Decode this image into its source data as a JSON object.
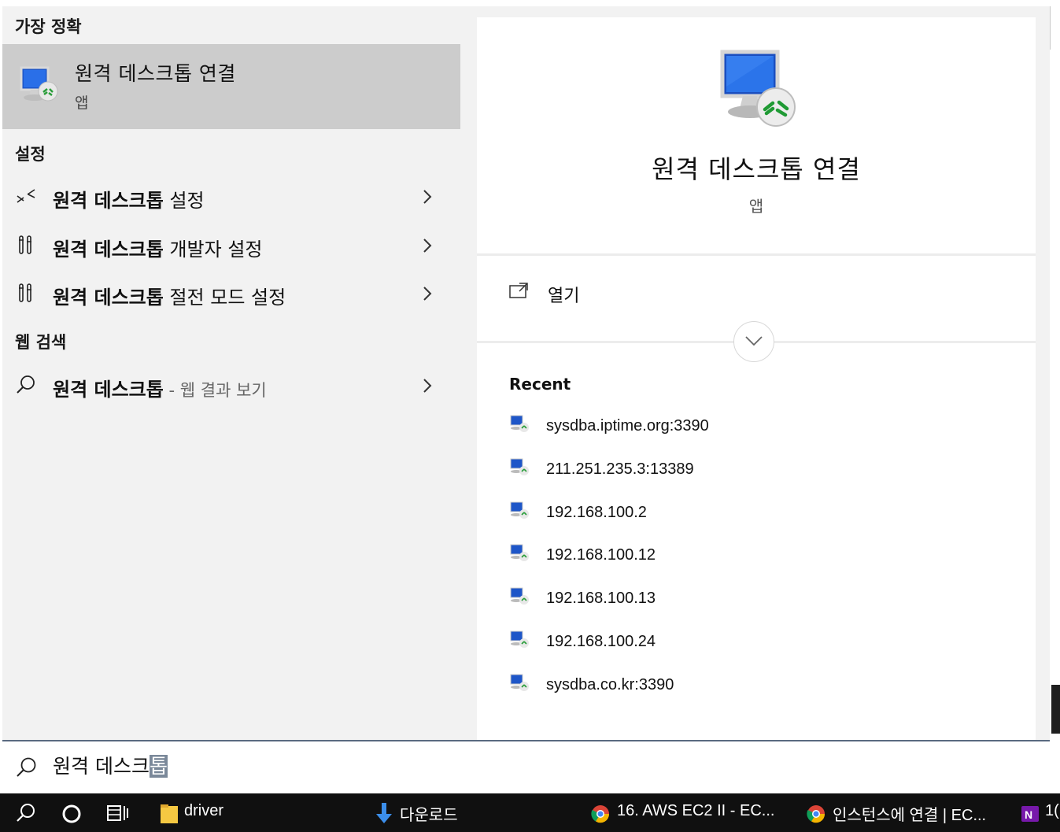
{
  "left": {
    "best_match_header": "가장 정확",
    "best_match": {
      "title": "원격 데스크톱 연결",
      "subtitle": "앱"
    },
    "settings_header": "설정",
    "settings": [
      {
        "bold": "원격 데스크톱",
        "rest": " 설정"
      },
      {
        "bold": "원격 데스크톱",
        "rest": " 개발자 설정"
      },
      {
        "bold": "원격 데스크톱",
        "rest": " 절전 모드 설정"
      }
    ],
    "web_header": "웹 검색",
    "web": {
      "bold": "원격 데스크톱",
      "suffix": " - 웹 결과 보기"
    }
  },
  "right": {
    "app_title": "원격 데스크톱 연결",
    "app_subtitle": "앱",
    "open_label": "열기",
    "recent_header": "Recent",
    "recent": [
      "sysdba.iptime.org:3390",
      "211.251.235.3:13389",
      "192.168.100.2",
      "192.168.100.12",
      "192.168.100.13",
      "192.168.100.24",
      "sysdba.co.kr:3390"
    ]
  },
  "search": {
    "typed": "원격 데스크",
    "selected": "톱"
  },
  "taskbar": {
    "folder_label": "driver",
    "downloads_label": "다운로드",
    "chrome_tab_1": "16. AWS EC2 II - EC...",
    "chrome_tab_2": "인스턴스에 연결 | EC...",
    "onenote_label": "1("
  },
  "colors": {
    "selected_bg": "#cccccc",
    "panel_bg": "#f2f2f2",
    "taskbar_bg": "#101010",
    "selection_highlight": "#7a8899"
  },
  "icons": [
    "remote-desktop-icon",
    "remote-settings-icon",
    "tools-icon",
    "chevron-right-icon",
    "search-icon",
    "open-icon",
    "chevron-down-icon",
    "cortana-icon",
    "task-view-icon",
    "folder-icon",
    "download-arrow-icon",
    "chrome-icon",
    "onenote-icon"
  ]
}
